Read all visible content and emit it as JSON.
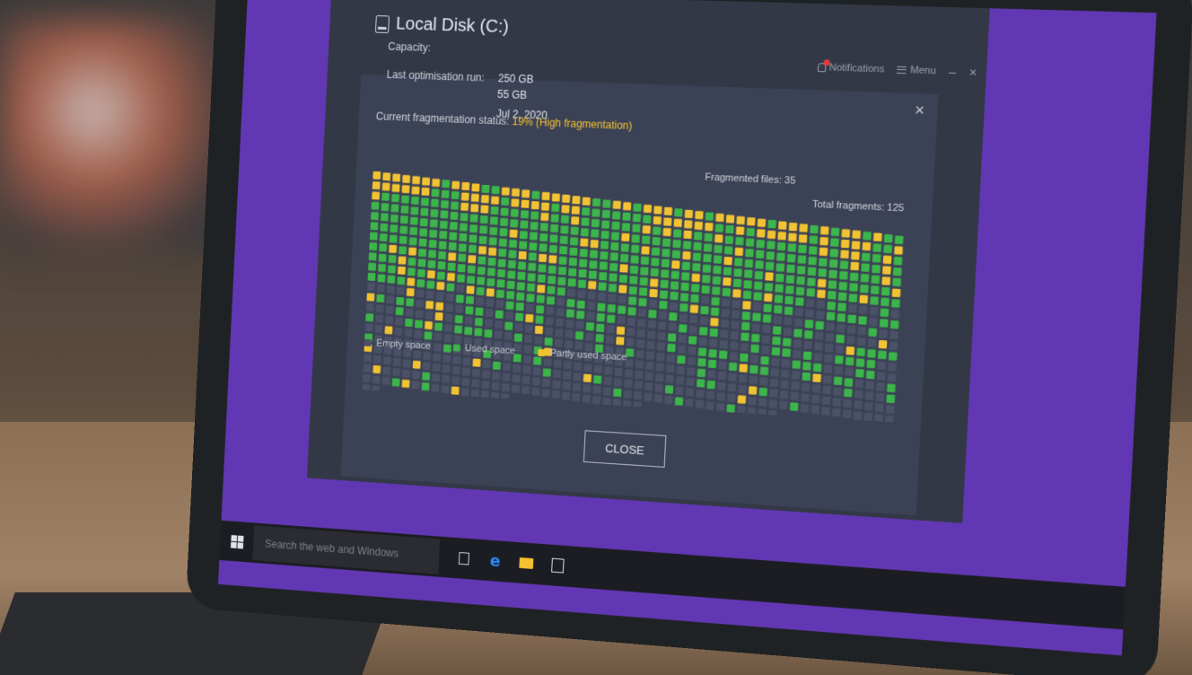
{
  "window": {
    "notifications_label": "Notifications",
    "menu_label": "Menu",
    "minimize_label": "–",
    "close_label": "×"
  },
  "dialog": {
    "title": "Local Disk (C:)",
    "close_icon": "×",
    "capacity_label": "Capacity:",
    "last_run_label": "Last optimisation run:",
    "values": [
      "250 GB",
      "55 GB",
      "Jul 2, 2020"
    ],
    "frag_status_label": "Current fragmentation status:",
    "frag_status_value": "19% (High fragmentation)",
    "fragmented_files": "Fragmented files: 35",
    "total_fragments": "Total fragments: 125",
    "legend": {
      "empty": "Empty space",
      "used": "Used space",
      "partly": "Partly used space"
    },
    "close_button": "CLOSE",
    "colors": {
      "empty": "#4b5166",
      "used": "#3cb54a",
      "partly": "#f1c232"
    }
  },
  "taskbar": {
    "search_placeholder": "Search the web and Windows",
    "icons": [
      "task-view-icon",
      "edge-icon",
      "file-explorer-icon",
      "store-icon"
    ]
  }
}
